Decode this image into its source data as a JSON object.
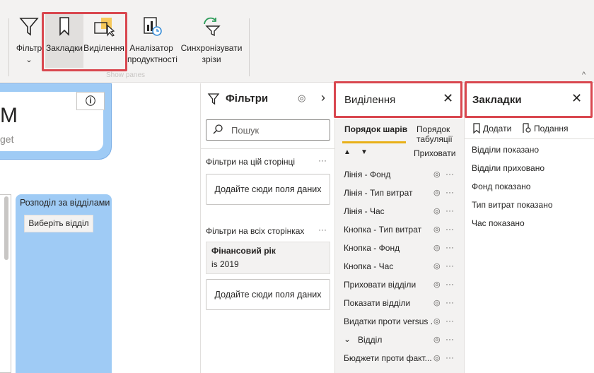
{
  "ribbon": {
    "buttons": {
      "filter": "Фільтр",
      "filter_chevron": "⌄",
      "bookmarks": "Закладки",
      "selection": "Виділення",
      "analyzer_line1": "Аналізатор",
      "analyzer_line2": "продуктності",
      "sync_line1": "Синхронізувати",
      "sync_line2": "зрізи"
    },
    "group_label": "Show panes",
    "collapse_icon": "^"
  },
  "canvas": {
    "big_letter": "M",
    "small_text": "get",
    "info_icon": "ⓘ",
    "dist_card_label": "Розподіл за відділами",
    "dist_select": "Виберіть відділ"
  },
  "filters_pane": {
    "title": "Фільтри",
    "search_placeholder": "Пошук",
    "section_page": "Фільтри на цій сторінці",
    "section_all": "Фільтри на всіх сторінках",
    "more": "···",
    "add_fields": "Додайте сюди поля даних",
    "fiscal_year": {
      "name": "Фінансовий рік",
      "value": "is 2019"
    },
    "chevron": "›"
  },
  "selection_pane": {
    "title": "Виділення",
    "close": "✕",
    "tab_layer_order": "Порядок шарів",
    "tab_tab_order_1": "Порядок",
    "tab_tab_order_2": "табуляції",
    "hide_label": "Приховати",
    "arrow_up": "▲",
    "arrow_down": "▼",
    "eye": "◎",
    "dots": "···",
    "layers": [
      "Лінія - Фонд",
      "Лінія - Тип витрат",
      "Лінія - Час",
      "Кнопка - Тип витрат",
      "Кнопка - Фонд",
      "Кнопка - Час",
      "Приховати відділи",
      "Показати відділи",
      "Видатки проти versus ...",
      "Відділ",
      "Бюджети проти факт..."
    ],
    "group_chevron": "⌄"
  },
  "bookmarks_pane": {
    "title": "Закладки",
    "close": "✕",
    "add": "Додати",
    "view": "Подання",
    "items": [
      "Відділи показано",
      "Відділи приховано",
      "Фонд показано",
      "Тип витрат показано",
      "Час показано"
    ]
  },
  "colors": {
    "highlight": "#d9474f",
    "card_blue": "#9fcbf5",
    "accent_yellow": "#e8b018"
  }
}
